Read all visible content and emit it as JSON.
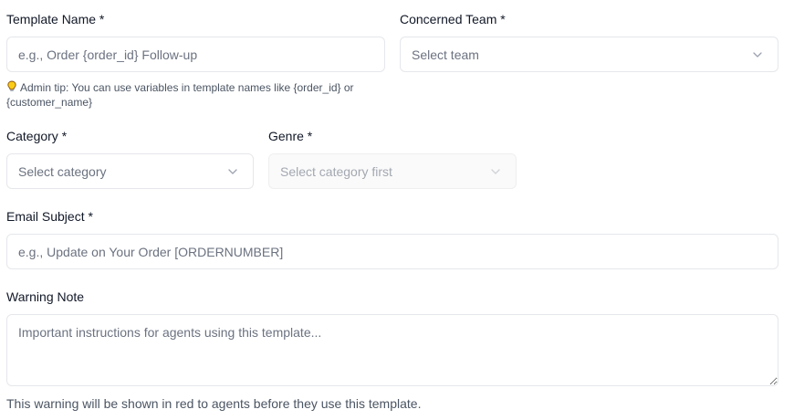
{
  "template_name": {
    "label": "Template Name *",
    "placeholder": "e.g., Order {order_id} Follow-up",
    "tip_icon": "lightbulb-icon",
    "tip": "Admin tip: You can use variables in template names like {order_id} or {customer_name}"
  },
  "concerned_team": {
    "label": "Concerned Team *",
    "value": "Select team"
  },
  "category": {
    "label": "Category *",
    "value": "Select category"
  },
  "genre": {
    "label": "Genre *",
    "value": "Select category first"
  },
  "email_subject": {
    "label": "Email Subject *",
    "placeholder": "e.g., Update on Your Order [ORDERNUMBER]"
  },
  "warning_note": {
    "label": "Warning Note",
    "placeholder": "Important instructions for agents using this template...",
    "help": "This warning will be shown in red to agents before they use this template."
  }
}
